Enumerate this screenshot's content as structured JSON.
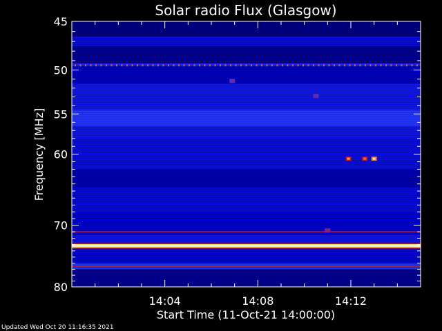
{
  "chart_data": {
    "type": "heatmap",
    "title": "Solar radio Flux (Glasgow)",
    "xlabel": "Start Time (11-Oct-21 14:00:00)",
    "ylabel": "Frequency [MHz]",
    "x_unit": "minutes after 14:00:00",
    "xlim": [
      0,
      15
    ],
    "x_ticks": [
      {
        "value": 4,
        "label": "14:04"
      },
      {
        "value": 8,
        "label": "14:08"
      },
      {
        "value": 12,
        "label": "14:12"
      }
    ],
    "y_scale": "log",
    "ylim": [
      45,
      80
    ],
    "y_ticks": [
      {
        "value": 45,
        "label": "45"
      },
      {
        "value": 50,
        "label": "50"
      },
      {
        "value": 55,
        "label": "55"
      },
      {
        "value": 60,
        "label": "60"
      },
      {
        "value": 70,
        "label": "70"
      },
      {
        "value": 80,
        "label": "80"
      }
    ],
    "colormap": [
      "#000030",
      "#0000c8",
      "#2a3cff",
      "#d01010",
      "#ffd040",
      "#ffffff"
    ],
    "bands": [
      {
        "freq_range": [
          45.0,
          46.5
        ],
        "level": 0.1
      },
      {
        "freq_range": [
          46.5,
          47.5
        ],
        "level": 0.25
      },
      {
        "freq_range": [
          47.5,
          49.3
        ],
        "level": 0.12
      },
      {
        "freq_range": [
          49.3,
          49.6
        ],
        "level": 0.35
      },
      {
        "freq_range": [
          49.6,
          51.5
        ],
        "level": 0.18
      },
      {
        "freq_range": [
          51.5,
          54.5
        ],
        "level": 0.3
      },
      {
        "freq_range": [
          54.5,
          56.5
        ],
        "level": 0.42
      },
      {
        "freq_range": [
          56.5,
          58.0
        ],
        "level": 0.3
      },
      {
        "freq_range": [
          58.0,
          62.0
        ],
        "level": 0.26
      },
      {
        "freq_range": [
          62.0,
          64.5
        ],
        "level": 0.16
      },
      {
        "freq_range": [
          64.5,
          68.0
        ],
        "level": 0.24
      },
      {
        "freq_range": [
          68.0,
          71.5
        ],
        "level": 0.2
      },
      {
        "freq_range": [
          71.5,
          73.5
        ],
        "level": 0.28
      },
      {
        "freq_range": [
          73.5,
          76.0
        ],
        "level": 0.22
      },
      {
        "freq_range": [
          76.0,
          77.0
        ],
        "level": 0.4
      },
      {
        "freq_range": [
          77.0,
          80.0
        ],
        "level": 0.12
      }
    ],
    "interference_lines": [
      {
        "freq": 73.2,
        "level": 1.0
      },
      {
        "freq": 49.5,
        "level": 0.65
      },
      {
        "freq": 76.5,
        "level": 0.5
      },
      {
        "freq": 71.0,
        "level": 0.5
      }
    ],
    "bursts": [
      {
        "time": 6.9,
        "freq": 51.2,
        "level": 0.6
      },
      {
        "time": 10.5,
        "freq": 52.9,
        "level": 0.6
      },
      {
        "time": 11.9,
        "freq": 60.6,
        "level": 0.85
      },
      {
        "time": 12.6,
        "freq": 60.6,
        "level": 0.8
      },
      {
        "time": 13.0,
        "freq": 60.6,
        "level": 0.95
      },
      {
        "time": 11.0,
        "freq": 70.8,
        "level": 0.65
      }
    ]
  },
  "footer": {
    "updated": "Updated Wed Oct 20 11:16:35 2021"
  }
}
